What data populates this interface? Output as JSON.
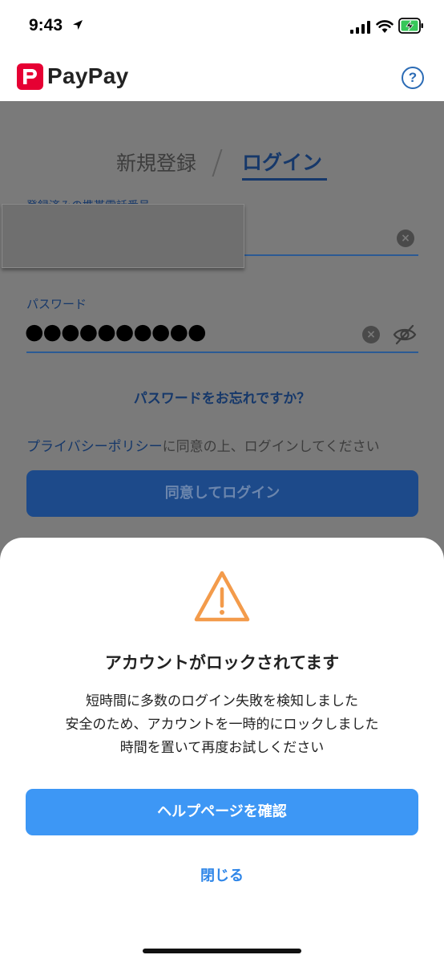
{
  "status_bar": {
    "time": "9:43",
    "icons": [
      "location-arrow-icon",
      "cellular-signal-icon",
      "wifi-icon",
      "battery-charging-icon"
    ]
  },
  "app_bar": {
    "logo_text": "PayPay",
    "help_icon_text": "?"
  },
  "tabs": {
    "register": "新規登録",
    "login": "ログイン"
  },
  "form": {
    "phone_label": "登録済みの携帯電話番号",
    "password_label": "パスワード",
    "password_mask": "●●●●●●●●●●",
    "clear_icon": "×",
    "forgot_password": "パスワードをお忘れですか？",
    "privacy_link": "プライバシーポリシー",
    "privacy_suffix": "に同意の上、ログインしてください",
    "login_button": "同意してログイン"
  },
  "sheet": {
    "title": "アカウントがロックされてます",
    "message_lines": [
      "短時間に多数のログイン失敗を検知しました",
      "安全のため、アカウントを一時的にロックしました",
      "時間を置いて再度お試しください"
    ],
    "help_button": "ヘルプページを確認",
    "close": "閉じる"
  },
  "colors": {
    "brand_red": "#e60033",
    "primary_blue": "#3d97f5",
    "link_blue": "#2f86e8",
    "warning_orange": "#f39b4b",
    "overlay": "#7a7a7a"
  }
}
